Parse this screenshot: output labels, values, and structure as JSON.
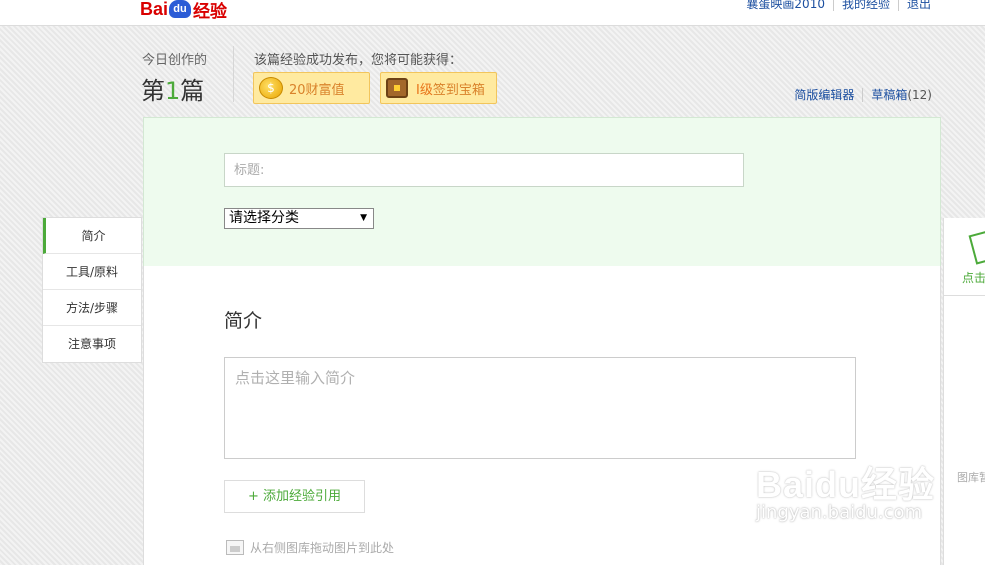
{
  "header": {
    "logo_text": "Bai",
    "logo_paw": "du",
    "logo_brand": "经验",
    "links": [
      "襄蛋映画2010",
      "我的经验",
      "退出"
    ]
  },
  "stats": {
    "label": "今日创作的",
    "prefix": "第",
    "count": "1",
    "suffix": "篇",
    "reward_label": "该篇经验成功发布，您将可能获得：",
    "wealth_badge": "20财富值",
    "chest_level": "Ⅰ级",
    "chest_badge": "签到宝箱"
  },
  "editor_links": {
    "simple_editor": "简版编辑器",
    "drafts": "草稿箱",
    "drafts_count": "(12)"
  },
  "form": {
    "title_placeholder": "标题:",
    "category_value": "请选择分类"
  },
  "nav": {
    "items": [
      "简介",
      "工具/原料",
      "方法/步骤",
      "注意事项"
    ],
    "active_index": 0
  },
  "content": {
    "section_title": "简介",
    "intro_placeholder": "点击这里输入简介",
    "add_reference": "+ 添加经验引用",
    "drag_hint": "从右侧图库拖动图片到此处"
  },
  "right_panel": {
    "head_label": "点击",
    "library_label": "图库暂"
  },
  "watermark": {
    "logo": "Baidu经验",
    "url": "jingyan.baidu.com"
  },
  "colors": {
    "accent_green": "#4caa3a",
    "link_blue": "#1c4fa0",
    "badge_bg": "#ffeaa0",
    "panel_green": "#eefbee"
  }
}
